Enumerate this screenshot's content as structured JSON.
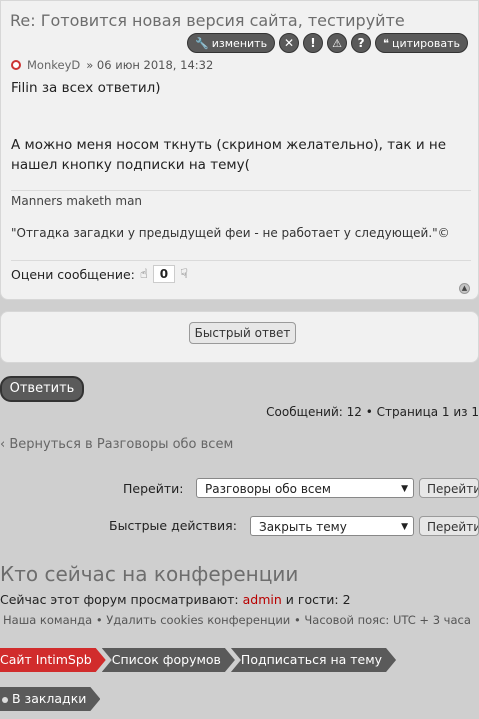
{
  "post": {
    "title": "Re: Готовится новая версия сайта, тестируйте",
    "tools": {
      "edit": "изменить",
      "quote": "цитировать"
    },
    "author": "MonkeyD",
    "date": "» 06 июн 2018, 14:32",
    "line1": "Filin за всех ответил)",
    "line2": "А можно меня носом ткнуть (скрином желательно), так и не нашел кнопку подписки на тему(",
    "signature1": "Manners maketh man",
    "signature2": "\"Отгадка загадки у предыдущей феи - не работает у следующей.\"©",
    "rate_label": "Оцени сообщение:",
    "rate_value": "0"
  },
  "quick_reply": "Быстрый ответ",
  "reply_button": "Ответить",
  "pagination": "Сообщений: 12 • Страница 1 из 1",
  "back_link": "‹ Вернуться в Разговоры обо всем",
  "jump": {
    "label": "Перейти:",
    "selected": "Разговоры обо всем",
    "button": "Перейти"
  },
  "quick_actions": {
    "label": "Быстрые действия:",
    "selected": "Закрыть тему",
    "button": "Перейти"
  },
  "who": {
    "title": "Кто сейчас на конференции",
    "prefix": "Сейчас этот форум просматривают:",
    "admin": "admin",
    "suffix": "и гости: 2"
  },
  "footer_links": {
    "team": "Наша команда",
    "cookies": "Удалить cookies конференции",
    "timezone": "Часовой пояс: UTC + 3 часа"
  },
  "breadcrumbs": [
    "Сайт IntimSpb",
    "Список форумов",
    "Подписаться на тему"
  ],
  "bookmarks": "В закладки",
  "colors": {
    "accent_red": "#d12c2c",
    "admin_red": "#b80000",
    "button_dark": "#5a5a5a"
  }
}
